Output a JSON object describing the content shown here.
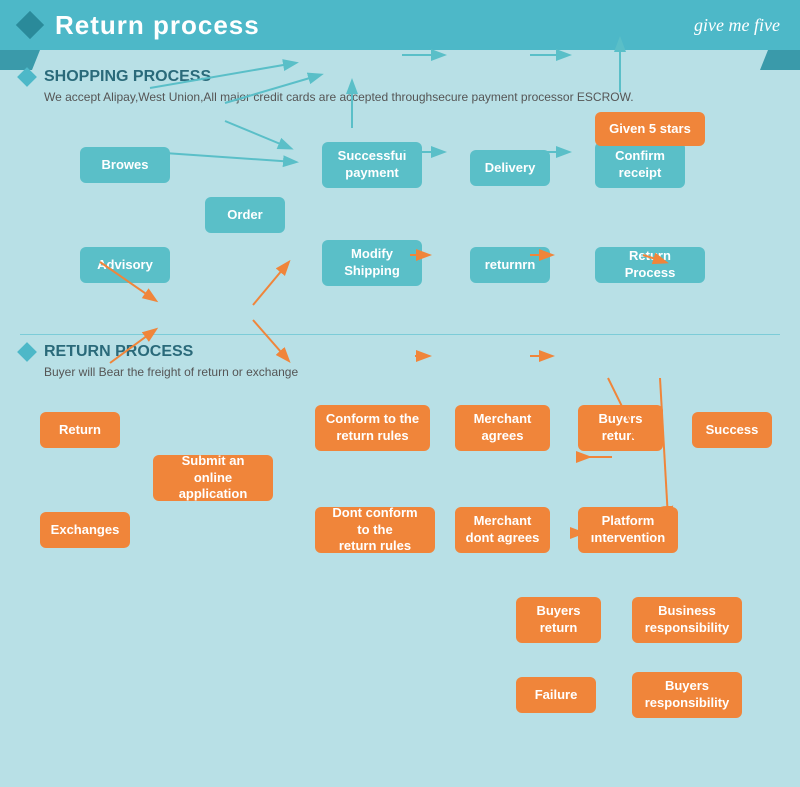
{
  "header": {
    "title": "Return process",
    "brand": "give me five"
  },
  "shopping": {
    "section_title": "SHOPPING PROCESS",
    "description": "We accept Alipay,West Union,All major credit cards are accepted throughsecure payment processor ESCROW.",
    "boxes": [
      {
        "id": "browes",
        "label": "Browes",
        "style": "teal"
      },
      {
        "id": "order",
        "label": "Order",
        "style": "teal"
      },
      {
        "id": "advisory",
        "label": "Advisory",
        "style": "teal"
      },
      {
        "id": "modify_shipping",
        "label": "Modify\nShipping",
        "style": "teal"
      },
      {
        "id": "successful_payment",
        "label": "Successful\npayment",
        "style": "teal"
      },
      {
        "id": "delivery",
        "label": "Delivery",
        "style": "teal"
      },
      {
        "id": "confirm_receipt",
        "label": "Confirm\nreceipt",
        "style": "teal"
      },
      {
        "id": "given_5_stars",
        "label": "Given 5 stars",
        "style": "orange"
      },
      {
        "id": "returnrn",
        "label": "returnrn",
        "style": "teal"
      },
      {
        "id": "return_process",
        "label": "Return Process",
        "style": "teal"
      }
    ]
  },
  "return_process": {
    "section_title": "RETURN PROCESS",
    "description": "Buyer will Bear the freight of return or exchange",
    "boxes": [
      {
        "id": "return_btn",
        "label": "Return",
        "style": "orange"
      },
      {
        "id": "exchanges_btn",
        "label": "Exchanges",
        "style": "orange"
      },
      {
        "id": "submit_online",
        "label": "Submit an online\napplication",
        "style": "orange"
      },
      {
        "id": "conform_rules",
        "label": "Conform to the\nreturn rules",
        "style": "orange"
      },
      {
        "id": "dont_conform",
        "label": "Dont conform to the\nreturn rules",
        "style": "orange"
      },
      {
        "id": "merchant_agrees",
        "label": "Merchant\nagrees",
        "style": "orange"
      },
      {
        "id": "merchant_dont",
        "label": "Merchant\ndont agrees",
        "style": "orange"
      },
      {
        "id": "buyers_return1",
        "label": "Buyers\nreturn",
        "style": "orange"
      },
      {
        "id": "buyers_return2",
        "label": "Buyers\nreturn",
        "style": "orange"
      },
      {
        "id": "platform_intervention",
        "label": "Platform\nintervention",
        "style": "orange"
      },
      {
        "id": "success",
        "label": "Success",
        "style": "orange"
      },
      {
        "id": "business_resp",
        "label": "Business\nresponsibility",
        "style": "orange"
      },
      {
        "id": "buyers_resp",
        "label": "Buyers\nresponsibility",
        "style": "orange"
      },
      {
        "id": "failure",
        "label": "Failure",
        "style": "orange"
      }
    ]
  }
}
